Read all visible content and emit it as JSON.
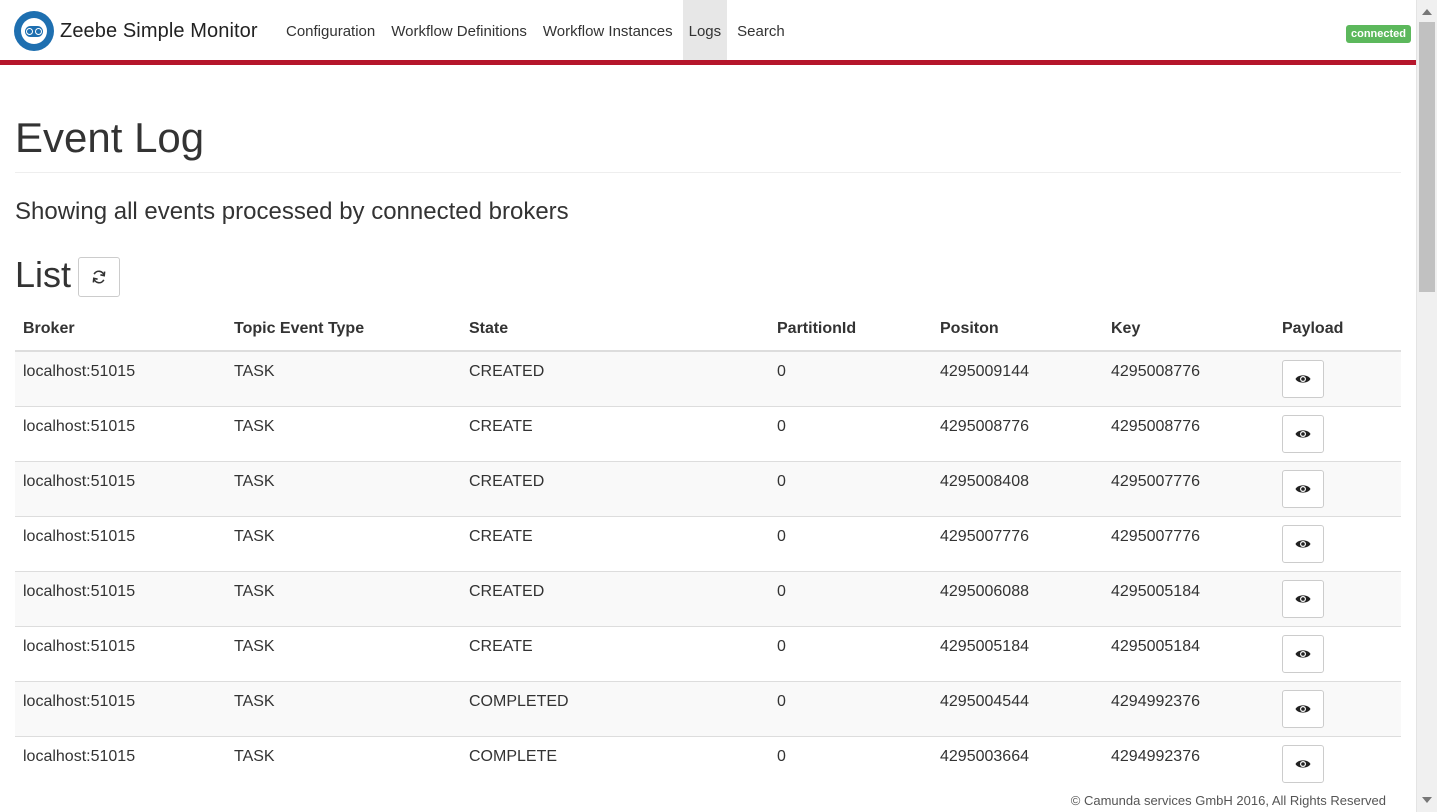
{
  "app": {
    "brand_name": "Zeebe Simple Monitor",
    "logo_icon": "zeebe-robot-logo",
    "accent_color": "#b5152b",
    "connection_status": "connected",
    "connection_status_color": "#5cb85c"
  },
  "nav": {
    "items": [
      {
        "label": "Configuration",
        "active": false
      },
      {
        "label": "Workflow Definitions",
        "active": false
      },
      {
        "label": "Workflow Instances",
        "active": false
      },
      {
        "label": "Logs",
        "active": true
      },
      {
        "label": "Search",
        "active": false
      }
    ]
  },
  "main": {
    "title": "Event Log",
    "subtitle": "Showing all events processed by connected brokers",
    "list_heading": "List",
    "refresh_icon": "refresh-icon"
  },
  "table": {
    "columns": [
      "Broker",
      "Topic Event Type",
      "State",
      "PartitionId",
      "Positon",
      "Key",
      "Payload"
    ],
    "rows": [
      {
        "broker": "localhost:51015",
        "type": "TASK",
        "state": "CREATED",
        "partition": "0",
        "position": "4295009144",
        "key": "4295008776"
      },
      {
        "broker": "localhost:51015",
        "type": "TASK",
        "state": "CREATE",
        "partition": "0",
        "position": "4295008776",
        "key": "4295008776"
      },
      {
        "broker": "localhost:51015",
        "type": "TASK",
        "state": "CREATED",
        "partition": "0",
        "position": "4295008408",
        "key": "4295007776"
      },
      {
        "broker": "localhost:51015",
        "type": "TASK",
        "state": "CREATE",
        "partition": "0",
        "position": "4295007776",
        "key": "4295007776"
      },
      {
        "broker": "localhost:51015",
        "type": "TASK",
        "state": "CREATED",
        "partition": "0",
        "position": "4295006088",
        "key": "4295005184"
      },
      {
        "broker": "localhost:51015",
        "type": "TASK",
        "state": "CREATE",
        "partition": "0",
        "position": "4295005184",
        "key": "4295005184"
      },
      {
        "broker": "localhost:51015",
        "type": "TASK",
        "state": "COMPLETED",
        "partition": "0",
        "position": "4295004544",
        "key": "4294992376"
      },
      {
        "broker": "localhost:51015",
        "type": "TASK",
        "state": "COMPLETE",
        "partition": "0",
        "position": "4295003664",
        "key": "4294992376"
      }
    ],
    "payload_icon": "eye-icon"
  },
  "footer": {
    "text": "© Camunda services GmbH 2016, All Rights Reserved"
  }
}
